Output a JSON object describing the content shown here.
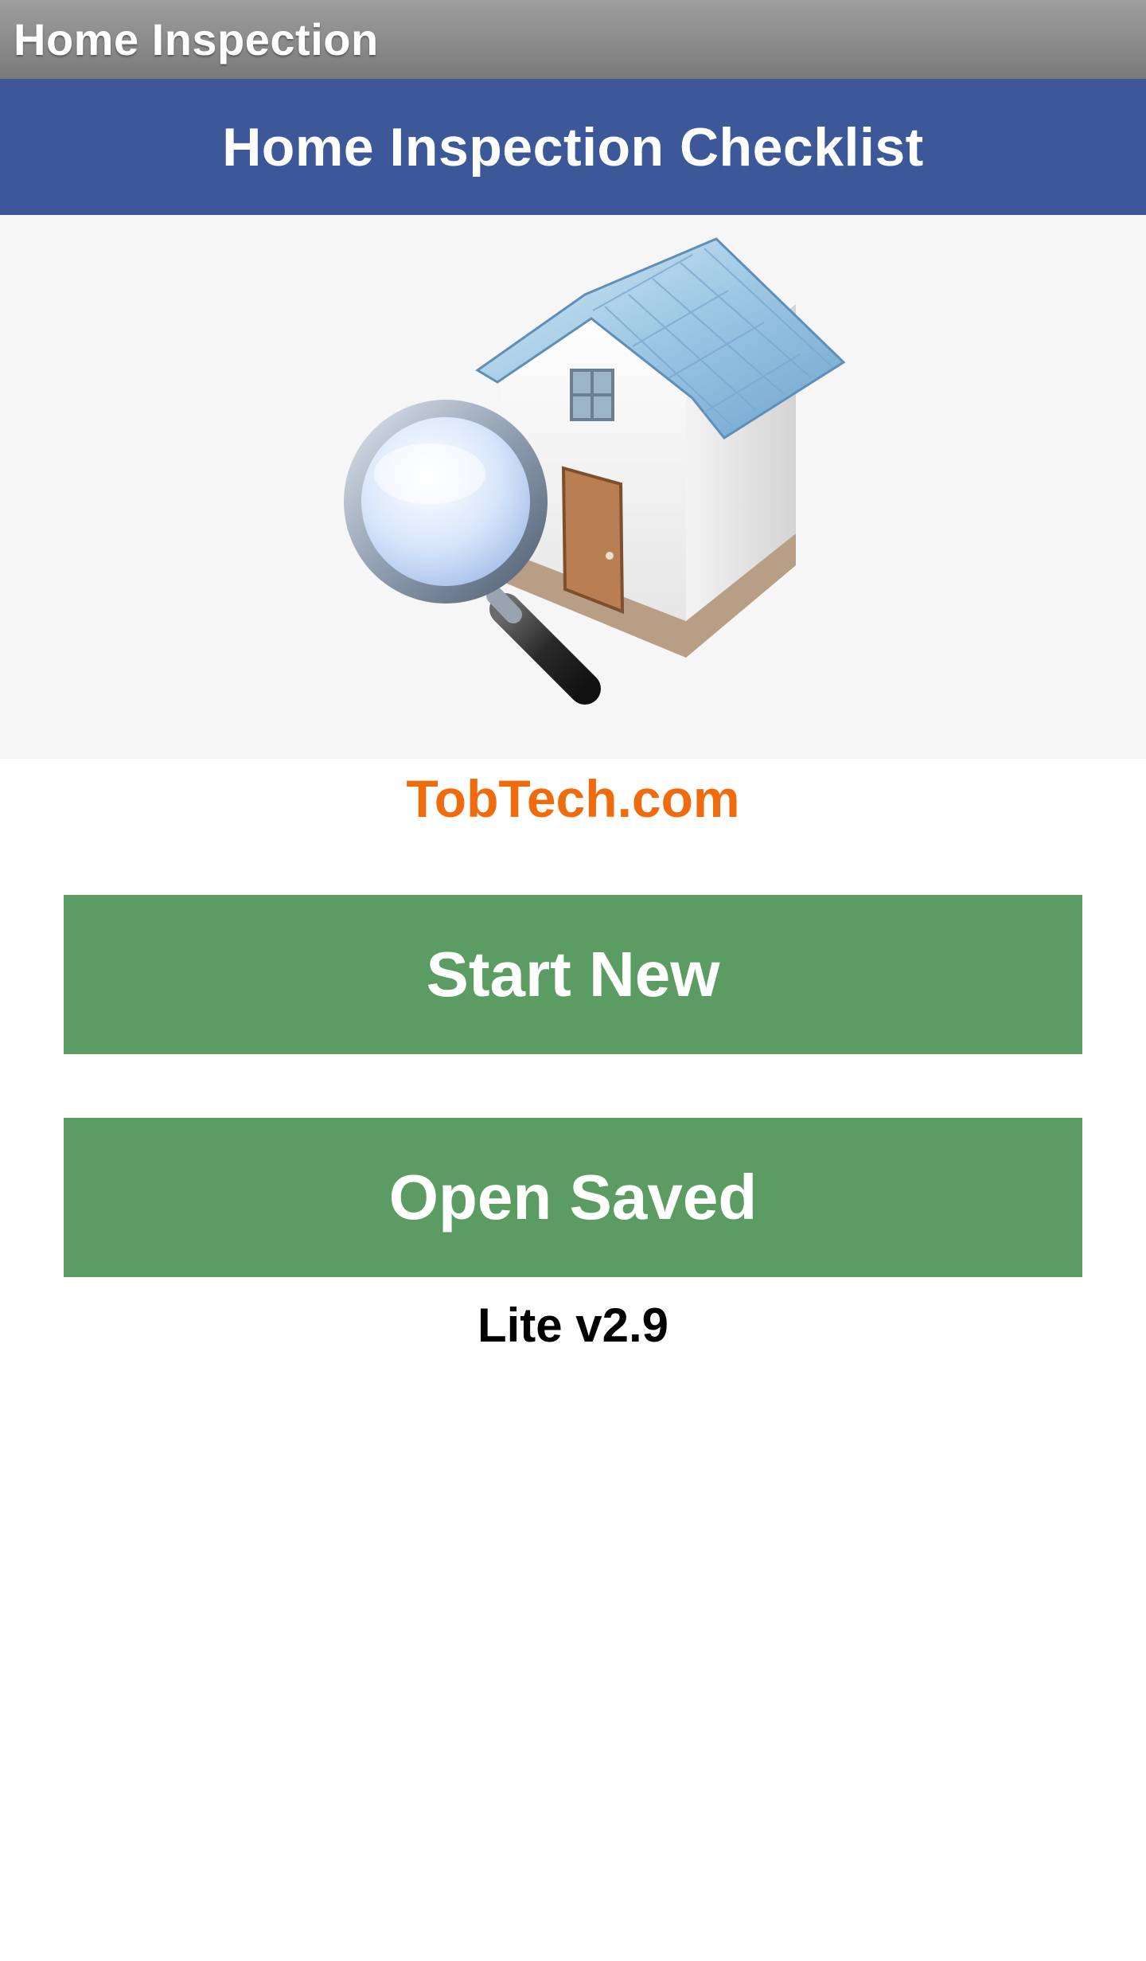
{
  "window": {
    "title": "Home Inspection"
  },
  "header": {
    "title": "Home Inspection Checklist",
    "background_color": "#3c5898"
  },
  "hero": {
    "icon": "house-with-magnifying-glass-icon"
  },
  "brand": {
    "link_text": "TobTech.com",
    "color": "#f06b0d"
  },
  "actions": {
    "start_new_label": "Start New",
    "open_saved_label": "Open Saved",
    "button_color": "#5b9c63"
  },
  "footer": {
    "version_label": "Lite v2.9"
  }
}
